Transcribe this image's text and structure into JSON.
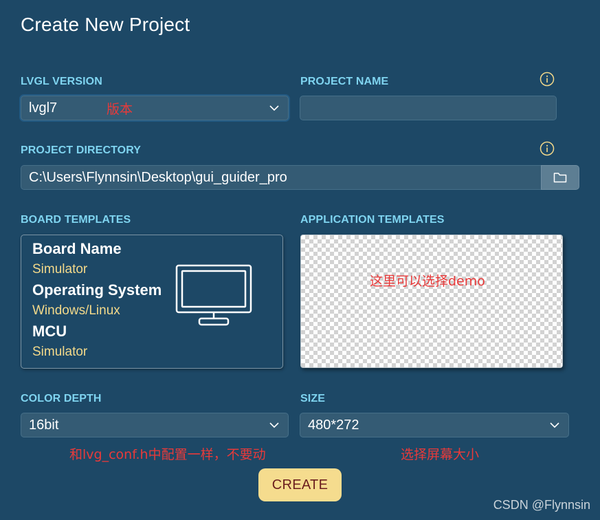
{
  "page": {
    "title": "Create New Project"
  },
  "lvgl_version": {
    "label": "LVGL VERSION",
    "value": "lvgl7",
    "icon": "chevron-down-icon"
  },
  "project_name": {
    "label": "PROJECT NAME",
    "value": "",
    "placeholder": "",
    "info_icon": "info-icon"
  },
  "project_directory": {
    "label": "PROJECT DIRECTORY",
    "value": "C:\\Users\\Flynnsin\\Desktop\\gui_guider_pro",
    "info_icon": "info-icon",
    "browse_icon": "folder-icon"
  },
  "board_templates": {
    "label": "BOARD TEMPLATES",
    "fields": [
      {
        "key": "Board Name",
        "value": "Simulator"
      },
      {
        "key": "Operating System",
        "value": "Windows/Linux"
      },
      {
        "key": "MCU",
        "value": "Simulator"
      }
    ],
    "icon": "monitor-icon"
  },
  "application_templates": {
    "label": "APPLICATION TEMPLATES"
  },
  "color_depth": {
    "label": "COLOR DEPTH",
    "value": "16bit",
    "icon": "chevron-down-icon"
  },
  "size": {
    "label": "SIZE",
    "value": "480*272",
    "icon": "chevron-down-icon"
  },
  "create_button": {
    "label": "CREATE"
  },
  "annotations": {
    "version": "版本",
    "app_templates": "这里可以选择demo",
    "color_depth": "和lvg_conf.h中配置一样，不要动",
    "size": "选择屏幕大小"
  },
  "watermark": "CSDN @Flynnsin",
  "colors": {
    "background": "#1d4866",
    "label": "#7fd4f0",
    "field_bg": "#345b74",
    "accent_yellow": "#f5dc8e",
    "value_yellow": "#f3d98a",
    "annotation_red": "#e83a3a",
    "button_text": "#6b1e1e"
  }
}
